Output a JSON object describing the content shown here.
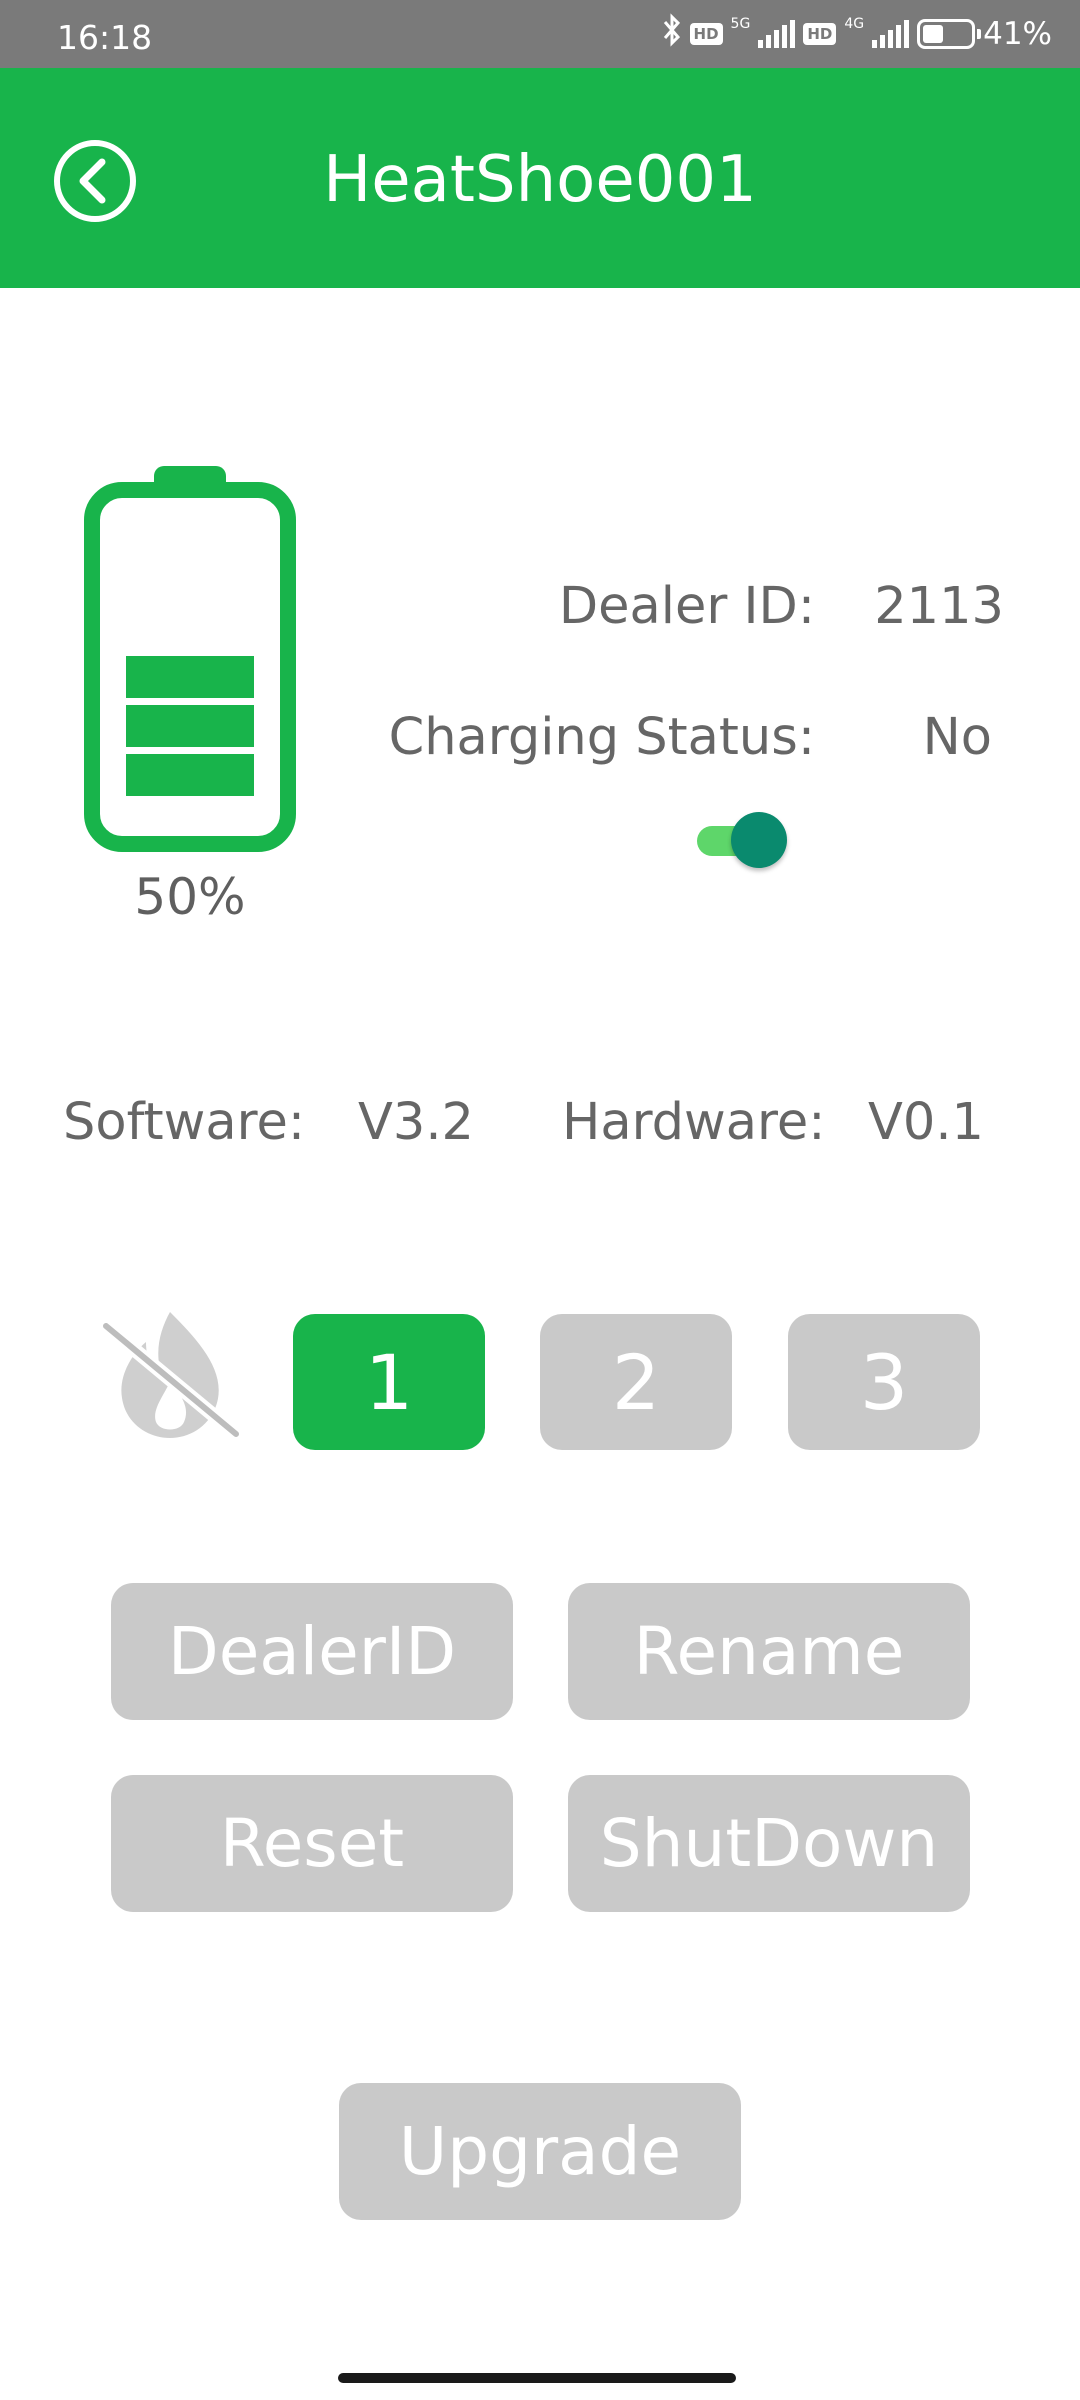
{
  "status_bar": {
    "time": "16:18",
    "hd_badge": "HD",
    "network_1": "5G",
    "network_2": "4G",
    "battery_percent": "41%",
    "icons": [
      "bluetooth-icon",
      "signal-icon",
      "battery-icon"
    ]
  },
  "header": {
    "title": "HeatShoe001",
    "back_icon": "back-circle-icon",
    "color": "#18b44b"
  },
  "battery": {
    "level": 0.5,
    "label": "50%",
    "color": "#18b44b"
  },
  "info": {
    "dealer_id_label": "Dealer ID:",
    "dealer_id_value": "2113",
    "charging_label": "Charging Status:",
    "charging_value": "No",
    "toggle_on": true,
    "software_label": "Software:",
    "software_value": "V3.2",
    "hardware_label": "Hardware:",
    "hardware_value": "V0.1"
  },
  "heat_levels": {
    "off_icon": "no-heat-icon",
    "levels": [
      "1",
      "2",
      "3"
    ],
    "selected": "1",
    "active_color": "#18b44b",
    "inactive_color": "#c9c9c9"
  },
  "actions": {
    "dealer_id": "DealerID",
    "rename": "Rename",
    "reset": "Reset",
    "shutdown": "ShutDown",
    "upgrade": "Upgrade"
  }
}
